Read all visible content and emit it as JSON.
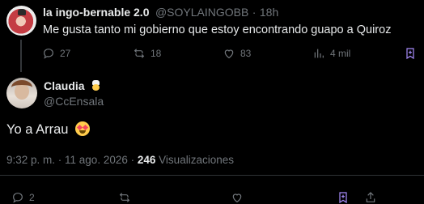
{
  "reply": {
    "display_name": "la ingo-bernable 2.0",
    "handle": "@SOYLAINGOBB",
    "separator": "·",
    "age": "18h",
    "text": "Me gusta tanto mi gobierno que estoy encontrando guapo a Quiroz",
    "stats": {
      "replies": "27",
      "reposts": "18",
      "likes": "83",
      "views": "4 mil"
    }
  },
  "main": {
    "display_name": "Claudia",
    "handle": "@CcEnsala",
    "name_emoji": "chef-emoji",
    "text": "Yo a Arrau",
    "text_emoji": "heart-eyes-emoji",
    "timestamp": "9:32 p. m. · 11 ago. 2026 ·",
    "views_count": "246",
    "views_label": "Visualizaciones",
    "stats": {
      "replies": "2"
    }
  },
  "icons": {
    "reply": "reply-icon",
    "repost": "repost-icon",
    "like": "heart-icon",
    "views": "views-icon",
    "bookmark": "bookmark-icon",
    "share": "share-icon"
  },
  "colors": {
    "background": "#000000",
    "text": "#e7e9ea",
    "muted": "#71767b",
    "bookmark_accent": "#a78bfa"
  }
}
